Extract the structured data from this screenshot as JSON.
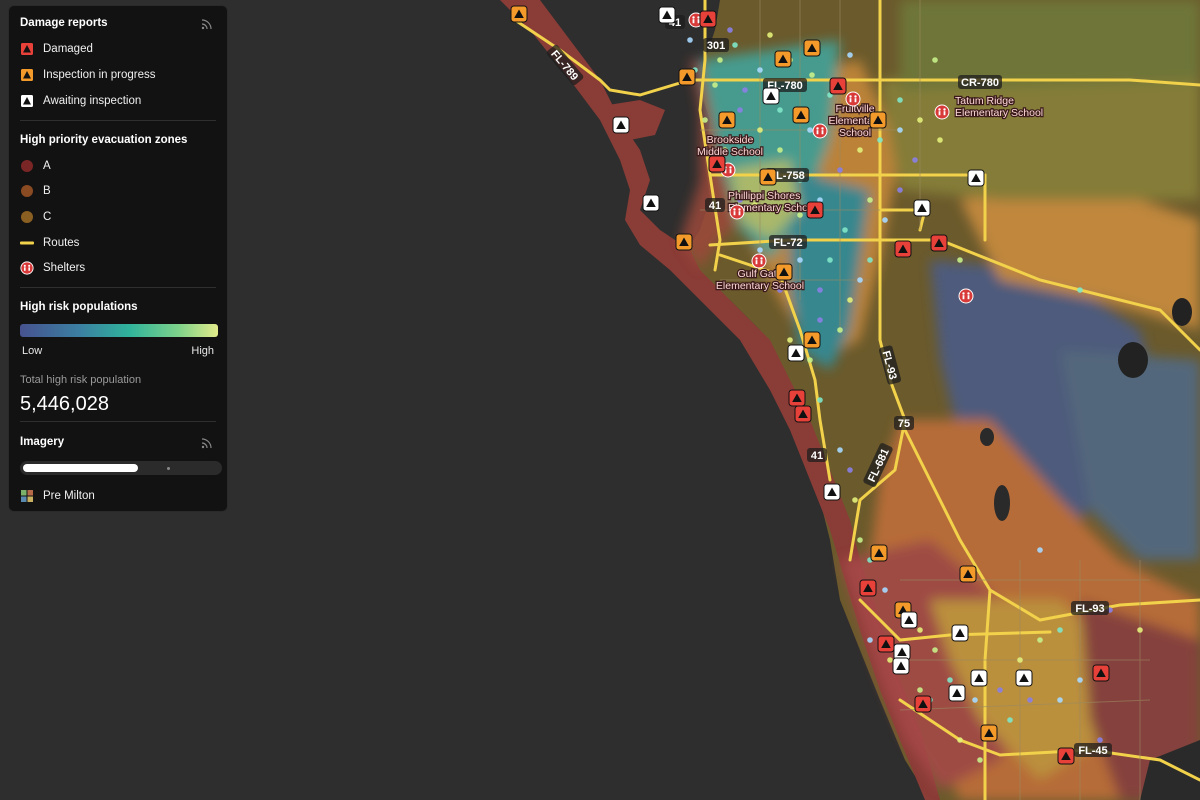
{
  "legend": {
    "damage_title": "Damage reports",
    "damage_items": [
      {
        "label": "Damaged",
        "color": "#e8413a"
      },
      {
        "label": "Inspection in progress",
        "color": "#f39a2b"
      },
      {
        "label": "Awaiting inspection",
        "color": "#ffffff"
      }
    ],
    "zones_title": "High priority evacuation zones",
    "zone_items": [
      {
        "label": "A",
        "color": "#7a2626"
      },
      {
        "label": "B",
        "color": "#8a4a22"
      },
      {
        "label": "C",
        "color": "#8a5f22"
      }
    ],
    "routes_label": "Routes",
    "routes_color": "#f2d14b",
    "shelters_label": "Shelters",
    "shelter_color": "#d83a3a",
    "risk_title": "High risk populations",
    "risk_low": "Low",
    "risk_high": "High",
    "total_label": "Total high risk population",
    "total_value": "5,446,028",
    "imagery_title": "Imagery",
    "imagery_progress": 0.5,
    "imagery_item": "Pre Milton"
  },
  "map": {
    "road_labels": [
      "FL-789",
      "FL-780",
      "CR-780",
      "FL-758",
      "FL-72",
      "FL-93",
      "FL-681",
      "FL-93",
      "FL-45",
      "301",
      "41",
      "41",
      "75",
      "41"
    ],
    "shelter_labels": [
      "Fruitville\nElementary\nSchool",
      "Tatum Ridge\nElementary School",
      "Brookside\nMiddle School",
      "Phillippi Shores\nElementary School",
      "Gulf Gate\nElementary School"
    ]
  }
}
